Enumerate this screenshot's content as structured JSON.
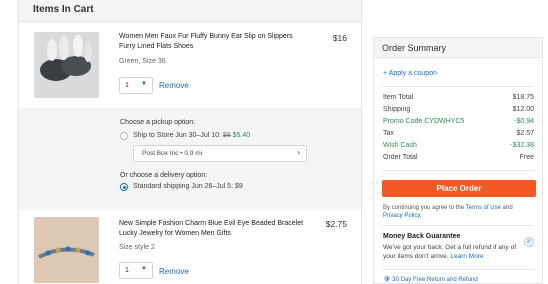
{
  "cart": {
    "header": "Items In Cart",
    "items": [
      {
        "title": "Women Men Faux Fur Fluffy Bunny Ear Slip on Slippers Furry Lined Flats Shoes",
        "price": "$16",
        "variant": "Green, Size 36",
        "qty": "1",
        "remove_label": "Remove"
      },
      {
        "title": "New Simple Fashion Charm Blue Evil Eye Beaded Bracelet Lucky Jewelry for Women Men Gifts",
        "price": "$2.75",
        "variant": "Size style 2",
        "qty": "1",
        "remove_label": "Remove"
      }
    ],
    "options": {
      "pickup_label": "Choose a pickup option:",
      "ship_to_store": "Ship to Store Jun 30–Jul 10:",
      "ship_to_store_old_price": "$9",
      "ship_to_store_price": "$5.40",
      "store_name": "Post Box Inc • 0.9 mi",
      "delivery_label": "Or choose a delivery option:",
      "standard_shipping": "Standard shipping Jun 26–Jul 5: $9"
    }
  },
  "summary": {
    "header": "Order Summary",
    "coupon_label": "+ Apply a coupon",
    "rows": [
      {
        "label": "Item Total",
        "value": "$18.75"
      },
      {
        "label": "Shipping",
        "value": "$12.00"
      },
      {
        "label": "Promo Code CYDWHYC5",
        "value": "-$0.94"
      },
      {
        "label": "Tax",
        "value": "$2.57"
      },
      {
        "label": "Wish Cash",
        "value": "-$32.38"
      },
      {
        "label": "Order Total",
        "value": "Free"
      }
    ],
    "place_order_label": "Place Order",
    "terms_prefix": "By continuing you agree to the",
    "terms_link": "Terms of Use",
    "terms_and": "and",
    "privacy_link": "Privacy Policy.",
    "guarantee_title": "Money Back Guarantee",
    "guarantee_text": "We've got your back. Get a full refund if any of your items don't arrive.",
    "learn_more": "Learn More",
    "return_text": "30 Day Free Return and Refund"
  },
  "colors": {
    "accent": "#1b6fb9",
    "cta": "#f15a24",
    "discount": "#2e8b57"
  }
}
